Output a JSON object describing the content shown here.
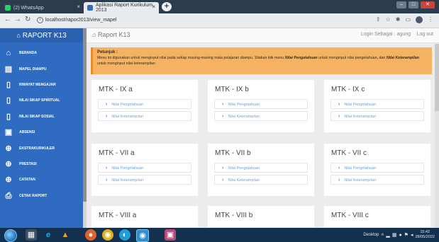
{
  "browser": {
    "tabs": [
      {
        "label": "(2) WhatsApp",
        "icon_color": "#25d366"
      },
      {
        "label": "Aplikasi Raport Kurikulum 2013",
        "icon_color": "#2f6cc1"
      }
    ],
    "url": "localhost/rapor2013/view_mapel",
    "close_glyph": "×",
    "new_tab_glyph": "+"
  },
  "sidebar": {
    "brand": "RAPORT K13",
    "items": [
      {
        "label": "BERANDA",
        "icon": "home-icon",
        "glyph": "⌂"
      },
      {
        "label": "MAPEL DIAMPU",
        "icon": "book-icon",
        "glyph": "▤"
      },
      {
        "label": "RIWAYAT MENGAJAR",
        "icon": "document-icon",
        "glyph": "▯"
      },
      {
        "label": "NILAI SIKAP SPIRITUAL",
        "icon": "document-icon",
        "glyph": "▯"
      },
      {
        "label": "NILAI SIKAP SOSIAL",
        "icon": "document-icon",
        "glyph": "▯"
      },
      {
        "label": "ABSENSI",
        "icon": "calendar-icon",
        "glyph": "▣"
      },
      {
        "label": "EKSTRAKURIKULER",
        "icon": "basketball-icon",
        "glyph": "⊕"
      },
      {
        "label": "PRESTASI",
        "icon": "basketball-icon",
        "glyph": "⊕"
      },
      {
        "label": "CATATAN",
        "icon": "basketball-icon",
        "glyph": "⊕"
      },
      {
        "label": "CETAK RAPORT",
        "icon": "print-icon",
        "glyph": "⎙"
      }
    ]
  },
  "header": {
    "title": "Raport K13",
    "user_info": "Login Sebagai : agung",
    "logout": "Log out"
  },
  "notice": {
    "title": "Petunjuk :",
    "text_a": "Menu ini digunakan untuk menginput nilai pada setiap masing-masing mata pelajaran diampu. Silakan klik menu ",
    "strong_a": "Nilai Pengetahuan",
    "text_b": " untuk menginput nilai pengetahuan, dan ",
    "strong_b": "Nilai Keterampilan",
    "text_c": " untuk menginput nilai keterampilan"
  },
  "cards": [
    {
      "title": "MTK - IX a",
      "links": [
        "Nilai Pengetahuan",
        "Nilai Keterampilan"
      ]
    },
    {
      "title": "MTK - IX b",
      "links": [
        "Nilai Pengetahuan",
        "Nilai Keterampilan"
      ]
    },
    {
      "title": "MTK - IX c",
      "links": [
        "Nilai Pengetahuan",
        "Nilai Keterampilan"
      ]
    },
    {
      "title": "MTK - VII a",
      "links": [
        "Nilai Pengetahuan",
        "Nilai Keterampilan"
      ]
    },
    {
      "title": "MTK - VII b",
      "links": [
        "Nilai Pengetahuan",
        "Nilai Keterampilan"
      ]
    },
    {
      "title": "MTK - VII c",
      "links": [
        "Nilai Pengetahuan",
        "Nilai Keterampilan"
      ]
    },
    {
      "title": "MTK - VIII a",
      "links": []
    },
    {
      "title": "MTK - VIII b",
      "links": []
    },
    {
      "title": "MTK - VIII c",
      "links": []
    }
  ],
  "taskbar": {
    "desktop_label": "Desktop",
    "time": "15:42",
    "date": "28/05/2022"
  },
  "colors": {
    "sidebar": "#2f6cc1",
    "notice": "#f4b262",
    "link": "#6fa3d9"
  }
}
